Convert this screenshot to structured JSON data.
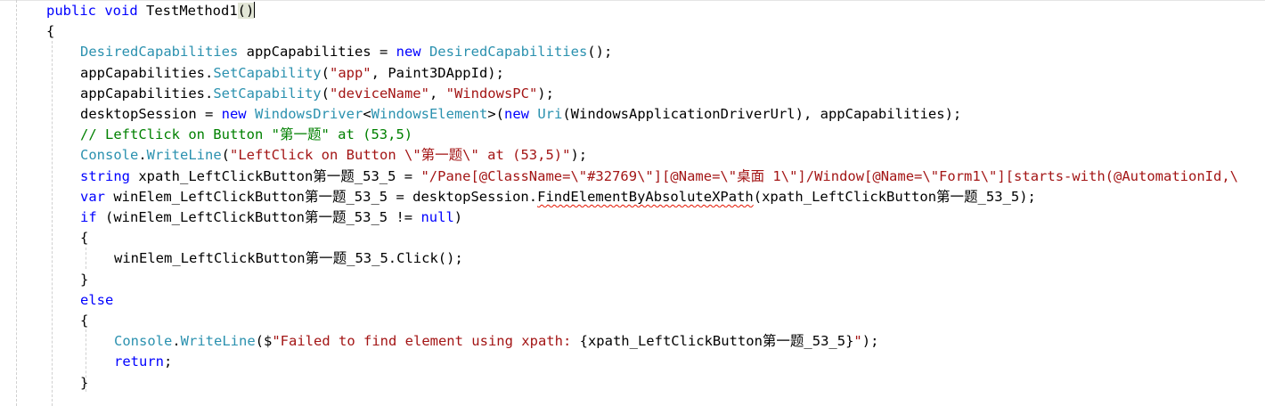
{
  "code_lines": [
    {
      "indent": 1,
      "tokens": [
        {
          "t": "public",
          "c": "kw"
        },
        {
          "t": " ",
          "c": "pl"
        },
        {
          "t": "void",
          "c": "kw"
        },
        {
          "t": " TestMethod1",
          "c": "pl"
        },
        {
          "t": "()",
          "c": "pl",
          "extra": "hl-paren"
        },
        {
          "t": "",
          "c": "pl",
          "caret": true
        }
      ]
    },
    {
      "indent": 1,
      "tokens": [
        {
          "t": "{",
          "c": "pl"
        }
      ]
    },
    {
      "indent": 2,
      "tokens": [
        {
          "t": "DesiredCapabilities",
          "c": "ty"
        },
        {
          "t": " appCapabilities = ",
          "c": "pl"
        },
        {
          "t": "new",
          "c": "kw"
        },
        {
          "t": " ",
          "c": "pl"
        },
        {
          "t": "DesiredCapabilities",
          "c": "ty"
        },
        {
          "t": "();",
          "c": "pl"
        }
      ]
    },
    {
      "indent": 2,
      "tokens": [
        {
          "t": "appCapabilities.",
          "c": "pl"
        },
        {
          "t": "SetCapability",
          "c": "ty"
        },
        {
          "t": "(",
          "c": "pl"
        },
        {
          "t": "\"app\"",
          "c": "str"
        },
        {
          "t": ", Paint3DAppId);",
          "c": "pl"
        }
      ]
    },
    {
      "indent": 2,
      "tokens": [
        {
          "t": "appCapabilities.",
          "c": "pl"
        },
        {
          "t": "SetCapability",
          "c": "ty"
        },
        {
          "t": "(",
          "c": "pl"
        },
        {
          "t": "\"deviceName\"",
          "c": "str"
        },
        {
          "t": ", ",
          "c": "pl"
        },
        {
          "t": "\"WindowsPC\"",
          "c": "str"
        },
        {
          "t": ");",
          "c": "pl"
        }
      ]
    },
    {
      "indent": 2,
      "tokens": [
        {
          "t": "desktopSession = ",
          "c": "pl"
        },
        {
          "t": "new",
          "c": "kw"
        },
        {
          "t": " ",
          "c": "pl"
        },
        {
          "t": "WindowsDriver",
          "c": "ty"
        },
        {
          "t": "<",
          "c": "pl"
        },
        {
          "t": "WindowsElement",
          "c": "ty"
        },
        {
          "t": ">(",
          "c": "pl"
        },
        {
          "t": "new",
          "c": "kw"
        },
        {
          "t": " ",
          "c": "pl"
        },
        {
          "t": "Uri",
          "c": "ty"
        },
        {
          "t": "(WindowsApplicationDriverUrl), appCapabilities);",
          "c": "pl"
        }
      ]
    },
    {
      "indent": 2,
      "tokens": [
        {
          "t": "// LeftClick on Button \"第一题\" at (53,5)",
          "c": "cm"
        }
      ]
    },
    {
      "indent": 2,
      "tokens": [
        {
          "t": "Console",
          "c": "ty"
        },
        {
          "t": ".",
          "c": "pl"
        },
        {
          "t": "WriteLine",
          "c": "ty"
        },
        {
          "t": "(",
          "c": "pl"
        },
        {
          "t": "\"LeftClick on Button \\\"第一题\\\" at (53,5)\"",
          "c": "str"
        },
        {
          "t": ");",
          "c": "pl"
        }
      ]
    },
    {
      "indent": 2,
      "tokens": [
        {
          "t": "string",
          "c": "kw"
        },
        {
          "t": " xpath_LeftClickButton第一题_53_5 = ",
          "c": "pl"
        },
        {
          "t": "\"/Pane[@ClassName=\\\"#32769\\\"][@Name=\\\"桌面 1\\\"]/Window[@Name=\\\"Form1\\\"][starts-with(@AutomationId,\\",
          "c": "str"
        }
      ]
    },
    {
      "indent": 2,
      "tokens": [
        {
          "t": "var",
          "c": "kw"
        },
        {
          "t": " winElem_LeftClickButton第一题_53_5 = desktopSession.",
          "c": "pl"
        },
        {
          "t": "FindElementByAbsoluteXPath",
          "c": "pl",
          "extra": "squiggle"
        },
        {
          "t": "(xpath_LeftClickButton第一题_53_5);",
          "c": "pl"
        }
      ]
    },
    {
      "indent": 2,
      "tokens": [
        {
          "t": "if",
          "c": "kw"
        },
        {
          "t": " (winElem_LeftClickButton第一题_53_5 != ",
          "c": "pl"
        },
        {
          "t": "null",
          "c": "kw"
        },
        {
          "t": ")",
          "c": "pl"
        }
      ]
    },
    {
      "indent": 2,
      "tokens": [
        {
          "t": "{",
          "c": "pl"
        }
      ]
    },
    {
      "indent": 3,
      "tokens": [
        {
          "t": "winElem_LeftClickButton第一题_53_5.Click();",
          "c": "pl"
        }
      ]
    },
    {
      "indent": 2,
      "tokens": [
        {
          "t": "}",
          "c": "pl"
        }
      ]
    },
    {
      "indent": 2,
      "tokens": [
        {
          "t": "else",
          "c": "kw"
        }
      ]
    },
    {
      "indent": 2,
      "tokens": [
        {
          "t": "{",
          "c": "pl"
        }
      ]
    },
    {
      "indent": 3,
      "tokens": [
        {
          "t": "Console",
          "c": "ty"
        },
        {
          "t": ".",
          "c": "pl"
        },
        {
          "t": "WriteLine",
          "c": "ty"
        },
        {
          "t": "($",
          "c": "pl"
        },
        {
          "t": "\"Failed to find element using xpath: ",
          "c": "str"
        },
        {
          "t": "{xpath_LeftClickButton第一题_53_5}",
          "c": "pl"
        },
        {
          "t": "\"",
          "c": "str"
        },
        {
          "t": ");",
          "c": "pl"
        }
      ]
    },
    {
      "indent": 3,
      "tokens": [
        {
          "t": "return",
          "c": "kw"
        },
        {
          "t": ";",
          "c": "pl"
        }
      ]
    },
    {
      "indent": 2,
      "tokens": [
        {
          "t": "}",
          "c": "pl"
        }
      ]
    }
  ],
  "colors": {
    "keyword": "#0000ff",
    "type": "#2b91af",
    "string": "#a31515",
    "comment": "#008000",
    "plain": "#000000",
    "squiggle": "#e51400",
    "indent_guide": "#d0d0d0",
    "background": "#ffffff"
  },
  "icons": [
    "error-squiggle"
  ]
}
